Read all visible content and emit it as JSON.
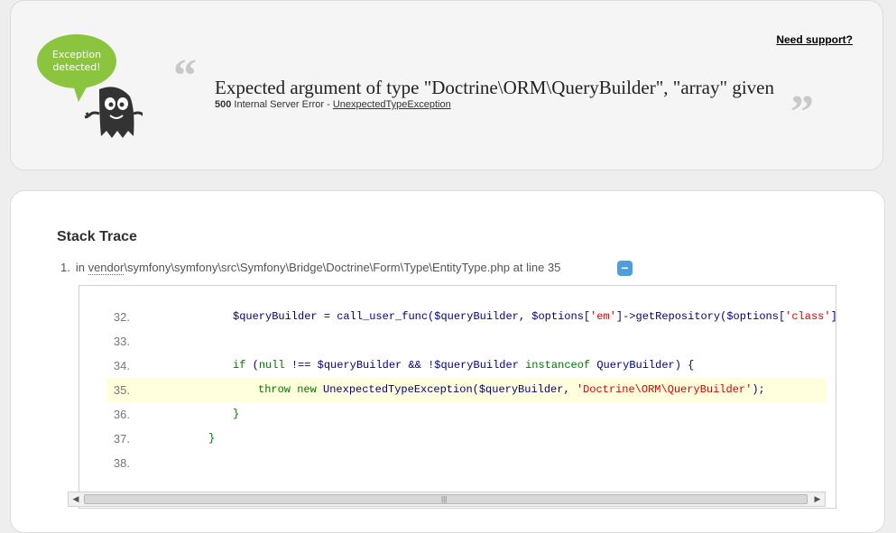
{
  "header": {
    "logo_text": [
      "Exception",
      "detected!"
    ],
    "support_link": "Need support?",
    "quote_open": "“",
    "quote_close": "”",
    "message": "Expected argument of type \"Doctrine\\ORM\\QueryBuilder\", \"array\" given",
    "status_code": "500",
    "status_text": "Internal Server Error - ",
    "exception_class": "UnexpectedTypeException"
  },
  "stack": {
    "title": "Stack Trace",
    "items": [
      {
        "index": "1.",
        "prefix": "in ",
        "vendor": "vendor",
        "path": "\\symfony\\symfony\\src\\Symfony\\Bridge\\Doctrine\\Form\\Type\\EntityType.php at line 35",
        "toggle": "−"
      }
    ]
  },
  "code": {
    "highlighted_line": "35.",
    "lines": [
      {
        "num": "32.",
        "text": "            $queryBuilder = call_user_func($queryBuilder, $options['em']->getRepository($options['class']));"
      },
      {
        "num": "33.",
        "text": ""
      },
      {
        "num": "34.",
        "text": "            if (null !== $queryBuilder && !$queryBuilder instanceof QueryBuilder) {"
      },
      {
        "num": "35.",
        "text": "                throw new UnexpectedTypeException($queryBuilder, 'Doctrine\\ORM\\QueryBuilder');"
      },
      {
        "num": "36.",
        "text": "            }"
      },
      {
        "num": "37.",
        "text": "        }"
      },
      {
        "num": "38.",
        "text": ""
      }
    ]
  },
  "scrollbar": {
    "left_arrow": "◀",
    "right_arrow": "▶",
    "grip": "|||"
  },
  "colors": {
    "toggle": "#4e9edb",
    "logo_bubble": "#8bc53f",
    "highlight": "#ffffdd"
  }
}
